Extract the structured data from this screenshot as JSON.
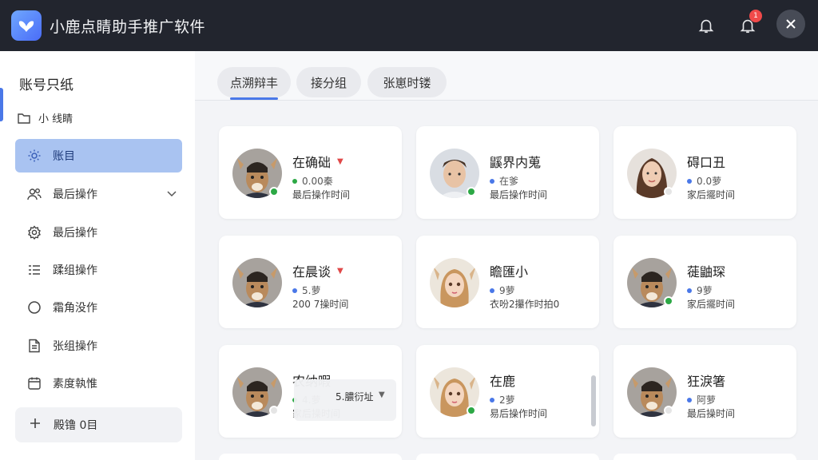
{
  "app": {
    "title": "小鹿点睛助手推广软件",
    "logo_icon": "butterfly-logo-icon",
    "notification_badge": "1"
  },
  "sidebar": {
    "heading": "账号只纸",
    "folder_label": "小 线睛",
    "items": [
      {
        "label": "账目",
        "icon": "gear-icon",
        "active": true
      },
      {
        "label": "最后操作",
        "icon": "users-icon",
        "has_chevron": true
      },
      {
        "label": "最后操作",
        "icon": "settings-icon"
      },
      {
        "label": "蹂组操作",
        "icon": "list-icon"
      },
      {
        "label": "霜角没作",
        "icon": "circle-icon"
      },
      {
        "label": "张组操作",
        "icon": "document-icon"
      },
      {
        "label": "素度執惟",
        "icon": "calendar-icon"
      }
    ],
    "add_label": "殿镥 0目"
  },
  "tabs": [
    {
      "label": "点溯辩丰",
      "active": true
    },
    {
      "label": "接分组",
      "active": false
    },
    {
      "label": "张崽时镂",
      "active": false
    }
  ],
  "cards": [
    {
      "name": "在确础",
      "line1": "0.00秦",
      "line2": "最后操作时间",
      "dot": "#2ca845",
      "line_dot": "#2ca845",
      "caret": true,
      "avatar": "deer"
    },
    {
      "name": "鼷界内蒐",
      "line1": "在爹",
      "line2": "最后操作时间",
      "dot": "#2ca845",
      "line_dot": "#4a78e8",
      "caret": false,
      "avatar": "man"
    },
    {
      "name": "碍口丑",
      "line1": "0.0萝",
      "line2": "家后擺时间",
      "dot": "#e5e5e5",
      "line_dot": "#4a78e8",
      "caret": false,
      "avatar": "woman"
    },
    {
      "name": "在晨谈",
      "line1": "5.萝",
      "line2": "200 7操时间",
      "dot": null,
      "line_dot": "#4a78e8",
      "caret": true,
      "avatar": "deer"
    },
    {
      "name": "瞻匯小",
      "line1": "9萝",
      "line2": "衣吩2攥作时拍0",
      "dot": null,
      "line_dot": "#4a78e8",
      "caret": false,
      "avatar": "doll"
    },
    {
      "name": "蓰鼬琛",
      "line1": "9萝",
      "line2": "家后擺时间",
      "dot": "#2ca845",
      "line_dot": "#4a78e8",
      "caret": false,
      "avatar": "deer"
    },
    {
      "name": "农纳暇",
      "line1": "4.萝",
      "line2": "家后操时间",
      "dot": "#e5e5e5",
      "line_dot": "#2ca845",
      "caret": false,
      "avatar": "deer"
    },
    {
      "name": "在鹿",
      "line1": "2萝",
      "line2": "易后操作时间",
      "dot": "#2ca845",
      "line_dot": "#4a78e8",
      "caret": false,
      "avatar": "doll"
    },
    {
      "name": "狂淚箸",
      "line1": "阿萝",
      "line2": "最后操时间",
      "dot": "#e5e5e5",
      "line_dot": "#4a78e8",
      "caret": false,
      "avatar": "deer"
    }
  ],
  "tooltip": {
    "text": "5.膿衍址"
  }
}
